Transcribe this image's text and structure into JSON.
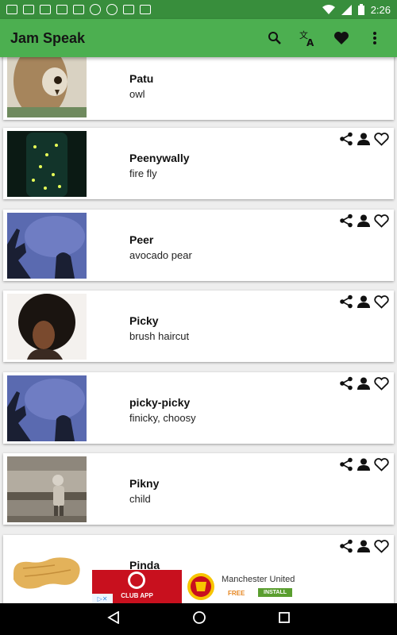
{
  "status_bar": {
    "time": "2:26",
    "notification_icons": [
      "gmail-icon",
      "mail-icon",
      "youtube-icon",
      "android-icon",
      "calendar-icon",
      "chat-icon",
      "chat-icon",
      "square-icon",
      "message-icon"
    ],
    "status_icons": [
      "wifi-icon",
      "signal-icon",
      "battery-icon"
    ]
  },
  "app_bar": {
    "title": "Jam Speak",
    "actions": [
      "search-icon",
      "translate-icon",
      "favorite-icon",
      "more-vert-icon"
    ]
  },
  "entries": [
    {
      "word": "Patu",
      "meaning": "owl",
      "image": "owl-photo"
    },
    {
      "word": "Peenywally",
      "meaning": "fire fly",
      "image": "firefly-jar-photo"
    },
    {
      "word": "Peer",
      "meaning": "avocado pear",
      "image": "shadow-hands-photo"
    },
    {
      "word": "Picky",
      "meaning": "brush haircut",
      "image": "afro-woman-photo"
    },
    {
      "word": "picky-picky",
      "meaning": "finicky, choosy",
      "image": "shadow-hands-photo"
    },
    {
      "word": "Pikny",
      "meaning": "child",
      "image": "child-photo"
    },
    {
      "word": "Pinda",
      "meaning": "",
      "image": "peanut-photo"
    }
  ],
  "card_actions": [
    "share-icon",
    "person-icon",
    "heart-outline-icon"
  ],
  "ad": {
    "left_text": "CLUB APP",
    "title": "Manchester United",
    "price": "FREE",
    "install": "INSTALL"
  },
  "colors": {
    "status_bar": "#388e3c",
    "app_bar": "#4caf50"
  },
  "nav_bar": [
    "back-icon",
    "home-icon",
    "recents-icon"
  ]
}
